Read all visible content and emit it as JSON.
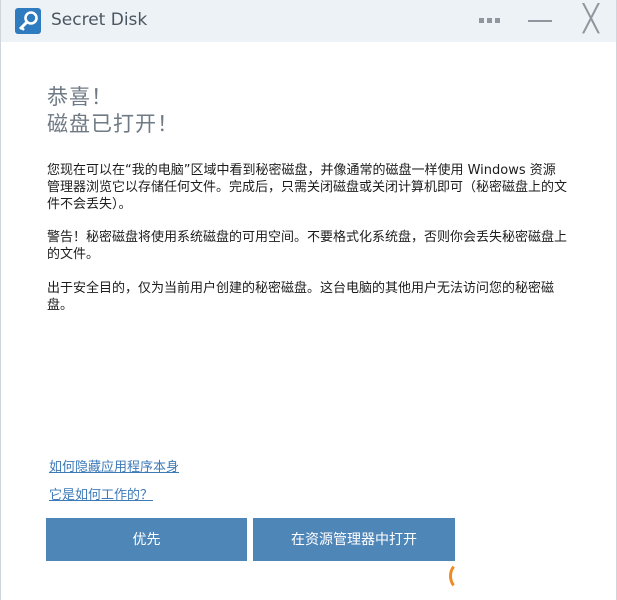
{
  "titlebar": {
    "app_title": "Secret Disk",
    "icon": "key-icon"
  },
  "content": {
    "heading_line1": "恭喜！",
    "heading_line2": "磁盘已打开！",
    "paragraph1": "您现在可以在“我的电脑”区域中看到秘密磁盘，并像通常的磁盘一样使用 Windows 资源管理器浏览它以存储任何文件。完成后，只需关闭磁盘或关闭计算机即可（秘密磁盘上的文件不会丢失）。",
    "paragraph2": "警告！秘密磁盘将使用系统磁盘的可用空间。不要格式化系统盘，否则你会丢失秘密磁盘上的文件。",
    "paragraph3": "出于安全目的，仅为当前用户创建的秘密磁盘。这台电脑的其他用户无法访问您的秘密磁盘。"
  },
  "links": {
    "hide_app": "如何隐藏应用程序本身",
    "how_it_works": "它是如何工作的？"
  },
  "buttons": {
    "first": "优先",
    "open_in_explorer": "在资源管理器中打开"
  },
  "colors": {
    "button_bg": "#4f86b8",
    "titlebar_bg": "#edf2f7",
    "accent": "#2f7bbf"
  }
}
